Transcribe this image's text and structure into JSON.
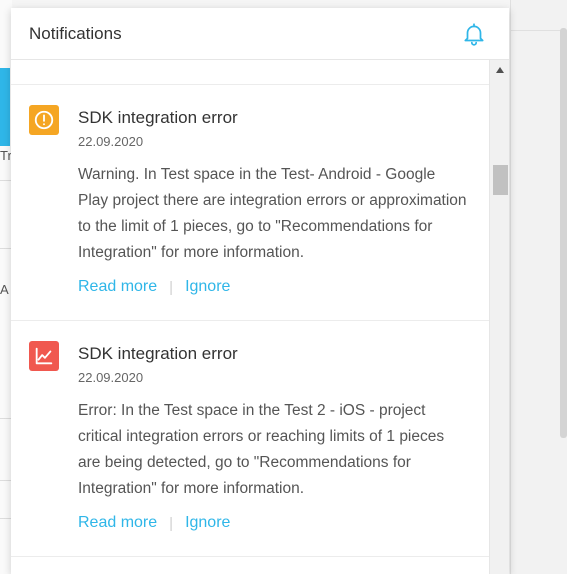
{
  "background": {
    "left_fragment_1": "Tr",
    "left_fragment_2": "A"
  },
  "panel": {
    "title": "Notifications",
    "icons": {
      "bell": "bell-icon"
    }
  },
  "notifications": [
    {
      "icon": "warning-circle-icon",
      "icon_color": "#f5a623",
      "title": "SDK integration error",
      "date": "22.09.2020",
      "text": "Warning. In Test space in the Test- Android - Google Play project there are integration errors or approximation to the limit of 1 pieces, go to \"Recommendations for Integration\" for more information.",
      "read_more": "Read more",
      "separator": "|",
      "ignore": "Ignore"
    },
    {
      "icon": "chart-line-icon",
      "icon_color": "#f0584f",
      "title": "SDK integration error",
      "date": "22.09.2020",
      "text": "Error: In the Test space in the Test 2 - iOS - project critical integration errors or reaching limits of 1 pieces are being detected, go to \"Recommendations for Integration\" for more information.",
      "read_more": "Read more",
      "separator": "|",
      "ignore": "Ignore"
    }
  ],
  "colors": {
    "accent": "#2fb6e8",
    "text_primary": "#333333",
    "text_secondary": "#555555"
  }
}
